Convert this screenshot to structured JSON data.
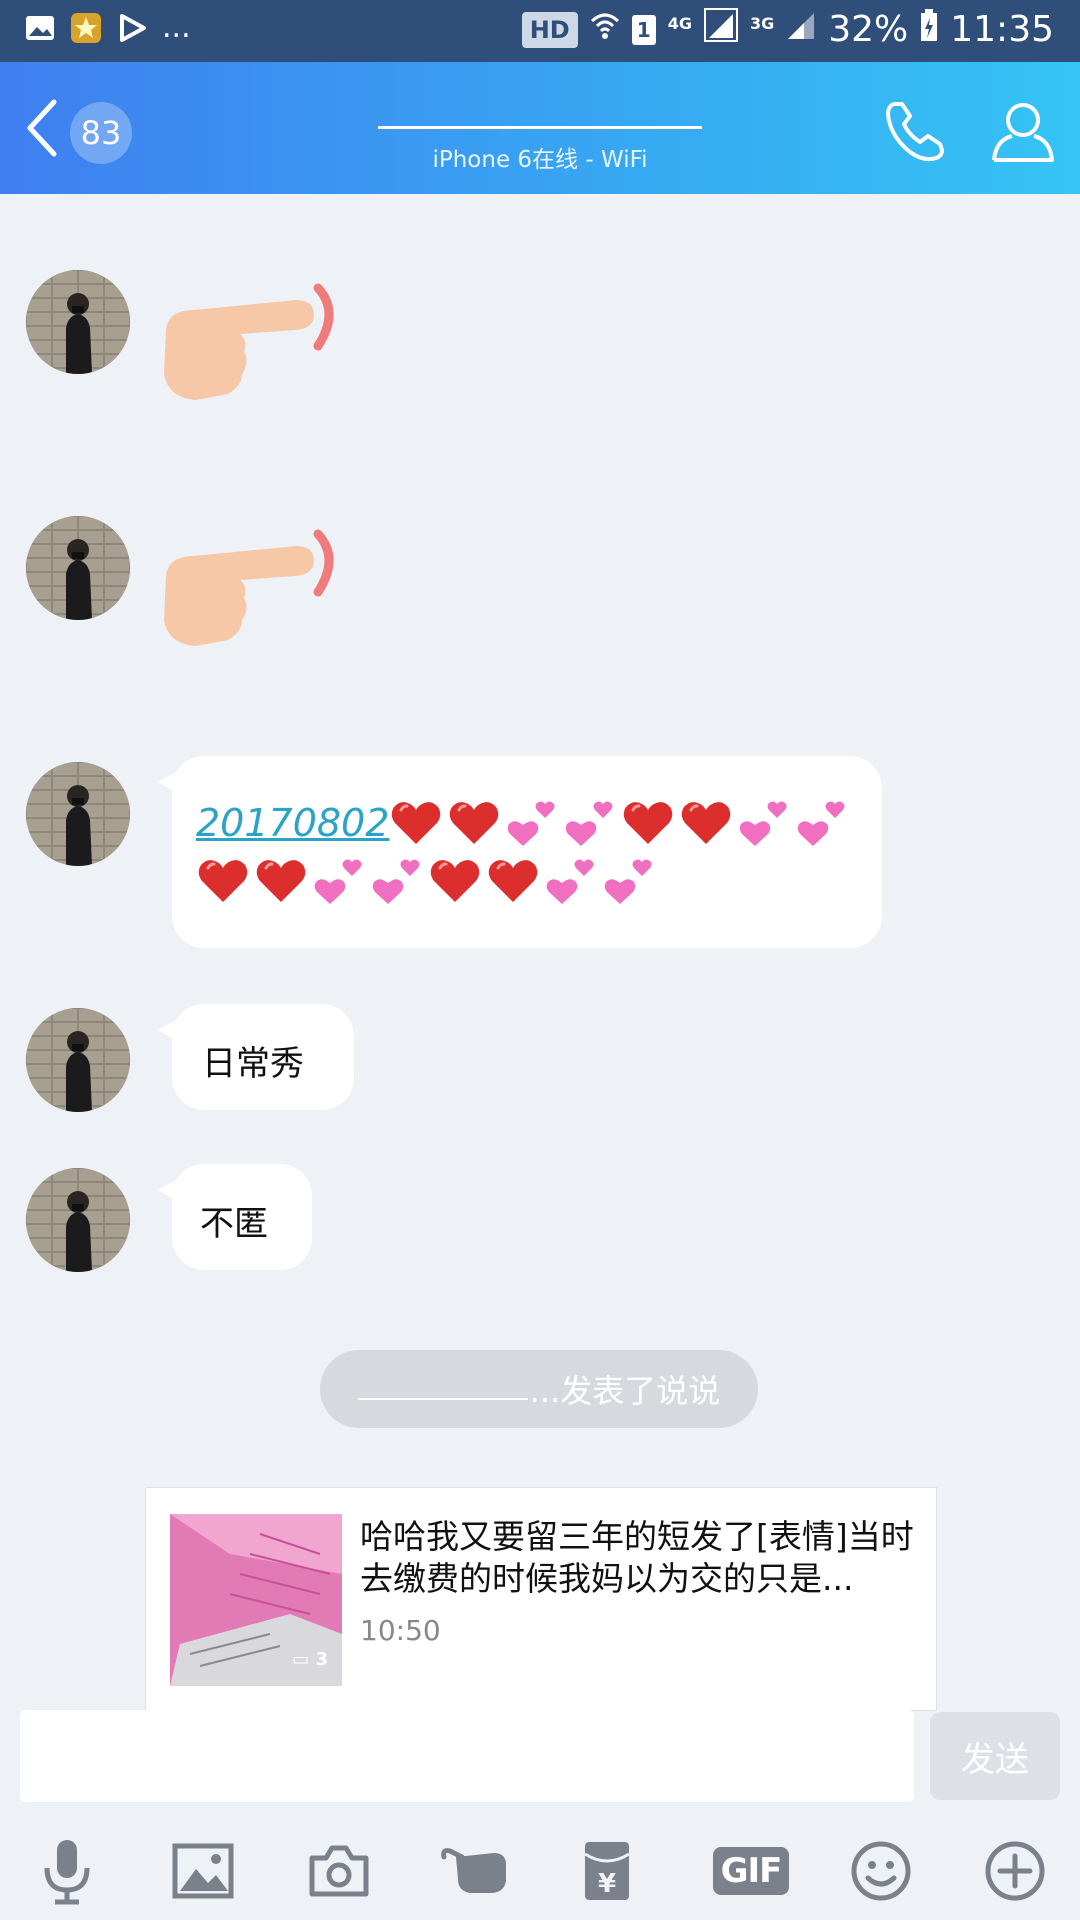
{
  "status_bar": {
    "more": "...",
    "hd": "HD",
    "sim": "1",
    "net1": "4G",
    "net2": "3G",
    "battery": "32%",
    "time": "11:35"
  },
  "header": {
    "unread_count": "83",
    "subtitle": "iPhone 6在线 - WiFi",
    "brand_color": "#3f7ff0"
  },
  "messages": [
    {
      "type": "emoji",
      "emoji": "pointing-finger"
    },
    {
      "type": "emoji",
      "emoji": "pointing-finger"
    },
    {
      "type": "text",
      "link": "20170802",
      "hearts": "red and pink hearts"
    },
    {
      "type": "text",
      "text": "日常秀"
    },
    {
      "type": "text",
      "text": "不匿"
    }
  ],
  "system_note": {
    "text": "...发表了说说"
  },
  "feed_card": {
    "text": "哈哈我又要留三年的短发了[表情]当时去缴费的时候我妈以为交的只是...",
    "time": "10:50",
    "image_count": "3"
  },
  "composer": {
    "input_value": "",
    "send_label": "发送"
  },
  "toolbar": {
    "items": [
      "microphone-icon",
      "image-icon",
      "camera-icon",
      "poke-icon",
      "red-packet-icon",
      "gif-icon",
      "emoji-icon",
      "plus-icon"
    ],
    "gif_label": "GIF",
    "red_packet_label": "¥"
  }
}
